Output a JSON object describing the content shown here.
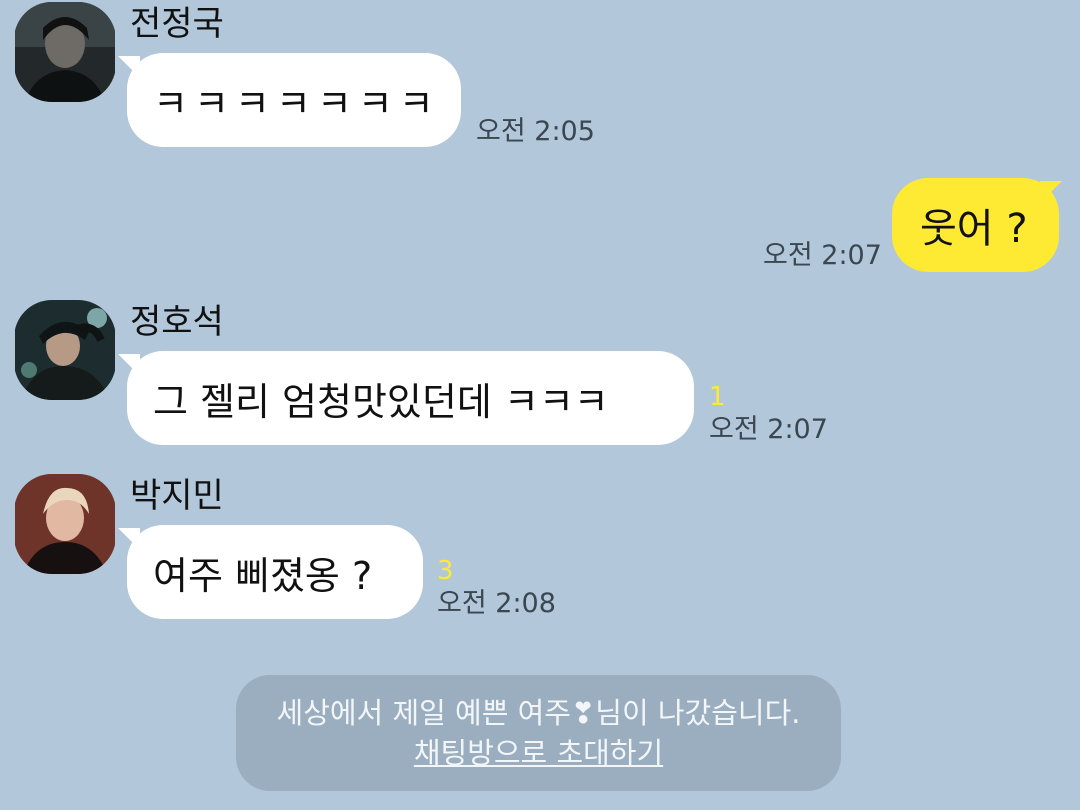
{
  "chat": {
    "messages": [
      {
        "sender": "전정국",
        "text": "ㅋㅋㅋㅋㅋㅋㅋ",
        "time": "오전 2:05",
        "unread": ""
      },
      {
        "sender": "",
        "text": "웃어 ?",
        "time": "오전 2:07",
        "unread": ""
      },
      {
        "sender": "정호석",
        "text": "그 젤리 엄청맛있던데 ㅋㅋㅋ",
        "time": "오전 2:07",
        "unread": "1"
      },
      {
        "sender": "박지민",
        "text": "여주 삐졌옹 ?",
        "time": "오전 2:08",
        "unread": "3"
      }
    ]
  },
  "notice": {
    "text": "세상에서 제일 예쁜 여주❣님이 나갔습니다.",
    "link": "채팅방으로 초대하기"
  },
  "colors": {
    "background": "#b2c7da",
    "my_bubble": "#fee933",
    "other_bubble": "#ffffff",
    "unread_count": "#fee933",
    "notice_box": "#9aaebf"
  }
}
